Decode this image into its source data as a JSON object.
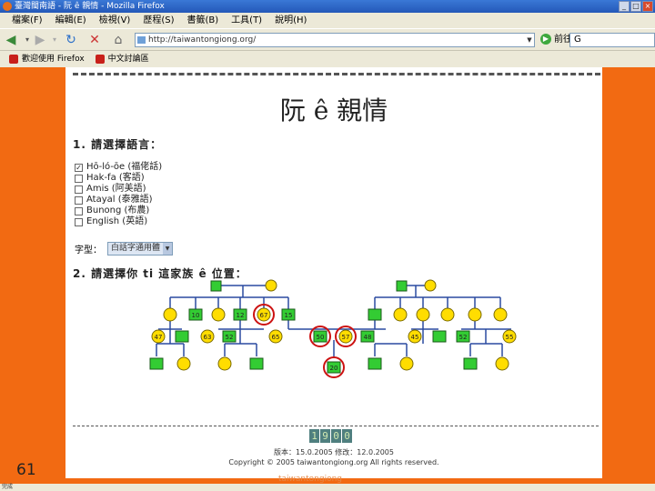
{
  "window": {
    "title": "臺灣閩南語 - 阮 ê 親情 - Mozilla Firefox"
  },
  "menu": [
    "檔案(F)",
    "編輯(E)",
    "檢視(V)",
    "歷程(S)",
    "書籤(B)",
    "工具(T)",
    "說明(H)"
  ],
  "navbar": {
    "url": "http://taiwantongiong.org/",
    "go_label": "前往",
    "search_value": "G"
  },
  "bookmarks": [
    "歡迎使用 Firefox",
    "中文討論區"
  ],
  "page": {
    "title": "阮 ê 親情",
    "step1": "1. 請選擇語言：",
    "languages": [
      {
        "label": "Hō-ló-ōe (福佬話)",
        "checked": true
      },
      {
        "label": "Hak-fa (客語)",
        "checked": false
      },
      {
        "label": "Amis (阿美語)",
        "checked": false
      },
      {
        "label": "Atayal (泰雅語)",
        "checked": false
      },
      {
        "label": "Bunong (布農)",
        "checked": false
      },
      {
        "label": "English (英語)",
        "checked": false
      }
    ],
    "font_label": "字型：",
    "font_value": "白話字通用體",
    "step2": "2. 請選擇你 ti 這家族 ê 位置：",
    "tree": {
      "left_parents": [
        "10",
        "12",
        "67",
        "15"
      ],
      "left_children": [
        "47",
        "",
        "63",
        "52",
        "65",
        "50"
      ],
      "right_children": [
        "57",
        "48",
        "45",
        "",
        "52",
        "55"
      ],
      "bottom": "20"
    },
    "counter": [
      "1",
      "9",
      "0",
      "0"
    ],
    "footer_dates": "版本：15.0.2005 修改：12.0.2005",
    "footer_copy": "Copyright © 2005 taiwantongiong.org All rights reserved."
  },
  "slide_number": "61",
  "status_text": "taiwantongiong",
  "status_left": "完成"
}
